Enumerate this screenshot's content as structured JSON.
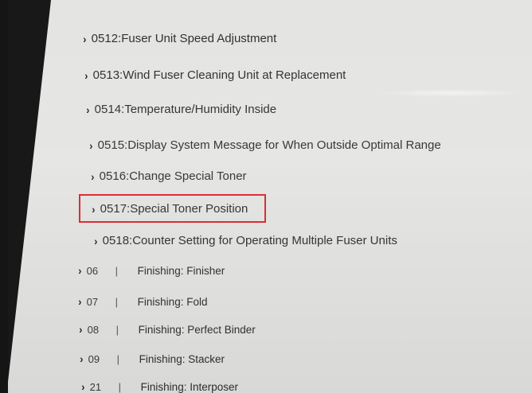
{
  "colors": {
    "screen_background": "#e4e4e2",
    "text": "#2e2e2e",
    "highlight_border": "#d9262b",
    "bezel": "#151515"
  },
  "icons": {
    "row_chevron": "chevron-right-icon"
  },
  "chevron_glyph": "›",
  "settings": [
    {
      "label": "0512:Fuser Unit Speed Adjustment"
    },
    {
      "label": "0513:Wind Fuser Cleaning Unit at Replacement"
    },
    {
      "label": "0514:Temperature/Humidity Inside"
    },
    {
      "label": "0515:Display System Message for When Outside Optimal Range"
    },
    {
      "label": "0516:Change Special Toner"
    },
    {
      "label": "0517:Special Toner Position",
      "highlighted": true
    },
    {
      "label": "0518:Counter Setting for Operating Multiple Fuser Units"
    }
  ],
  "categories": [
    {
      "number": "06",
      "separator": "|",
      "label": "Finishing: Finisher"
    },
    {
      "number": "07",
      "separator": "|",
      "label": "Finishing: Fold"
    },
    {
      "number": "08",
      "separator": "|",
      "label": "Finishing: Perfect Binder"
    },
    {
      "number": "09",
      "separator": "|",
      "label": "Finishing: Stacker"
    },
    {
      "number": "21",
      "separator": "|",
      "label": "Finishing: Interposer"
    }
  ]
}
